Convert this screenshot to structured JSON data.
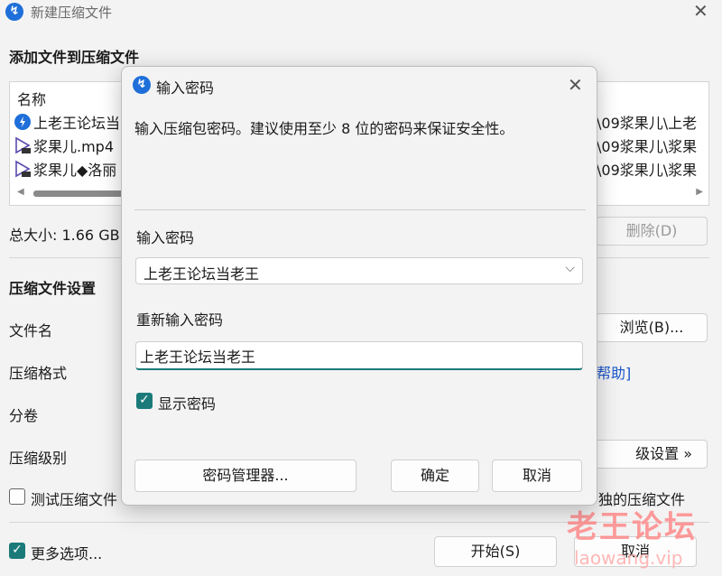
{
  "window": {
    "title": "新建压缩文件",
    "close_glyph": "✕"
  },
  "add_section": {
    "heading": "添加文件到压缩文件",
    "column_name": "名称",
    "files": [
      {
        "name": "上老王论坛当",
        "path": "\\09浆果儿\\上老",
        "icon": "app-icon"
      },
      {
        "name": "浆果儿.mp4",
        "path": "\\09浆果儿\\浆果",
        "icon": "video-icon"
      },
      {
        "name": "浆果儿◆洛丽",
        "path": "\\09浆果儿\\浆果",
        "icon": "video-icon"
      }
    ],
    "total_size": "总大小: 1.66 GB",
    "delete_button": "删除(D)"
  },
  "settings": {
    "heading": "压缩文件设置",
    "filename_label": "文件名",
    "browse_button": "浏览(B)...",
    "format_label": "压缩格式",
    "help_link": "帮助]",
    "volume_label": "分卷",
    "level_label": "压缩级别",
    "advanced_button": "级设置 »",
    "test_label": "测试压缩文件",
    "independent_label": "独的压缩文件"
  },
  "footer": {
    "more_options_label": "更多选项...",
    "start_button": "开始(S)",
    "cancel_button": "取消"
  },
  "dialog": {
    "title": "输入密码",
    "description": "输入压缩包密码。建议使用至少 8 位的密码来保证安全性。",
    "password_label": "输入密码",
    "password_value": "上老王论坛当老王",
    "repeat_label": "重新输入密码",
    "repeat_value": "上老王论坛当老王",
    "show_password_label": "显示密码",
    "show_password_checked": true,
    "manager_button": "密码管理器...",
    "ok_button": "确定",
    "cancel_button": "取消"
  },
  "watermark": {
    "line1": "老王论坛",
    "line2": "laowang.vip"
  },
  "colors": {
    "accent": "#1a7a7a",
    "link": "#1a56c8",
    "app_icon": "#1e6fd9"
  }
}
